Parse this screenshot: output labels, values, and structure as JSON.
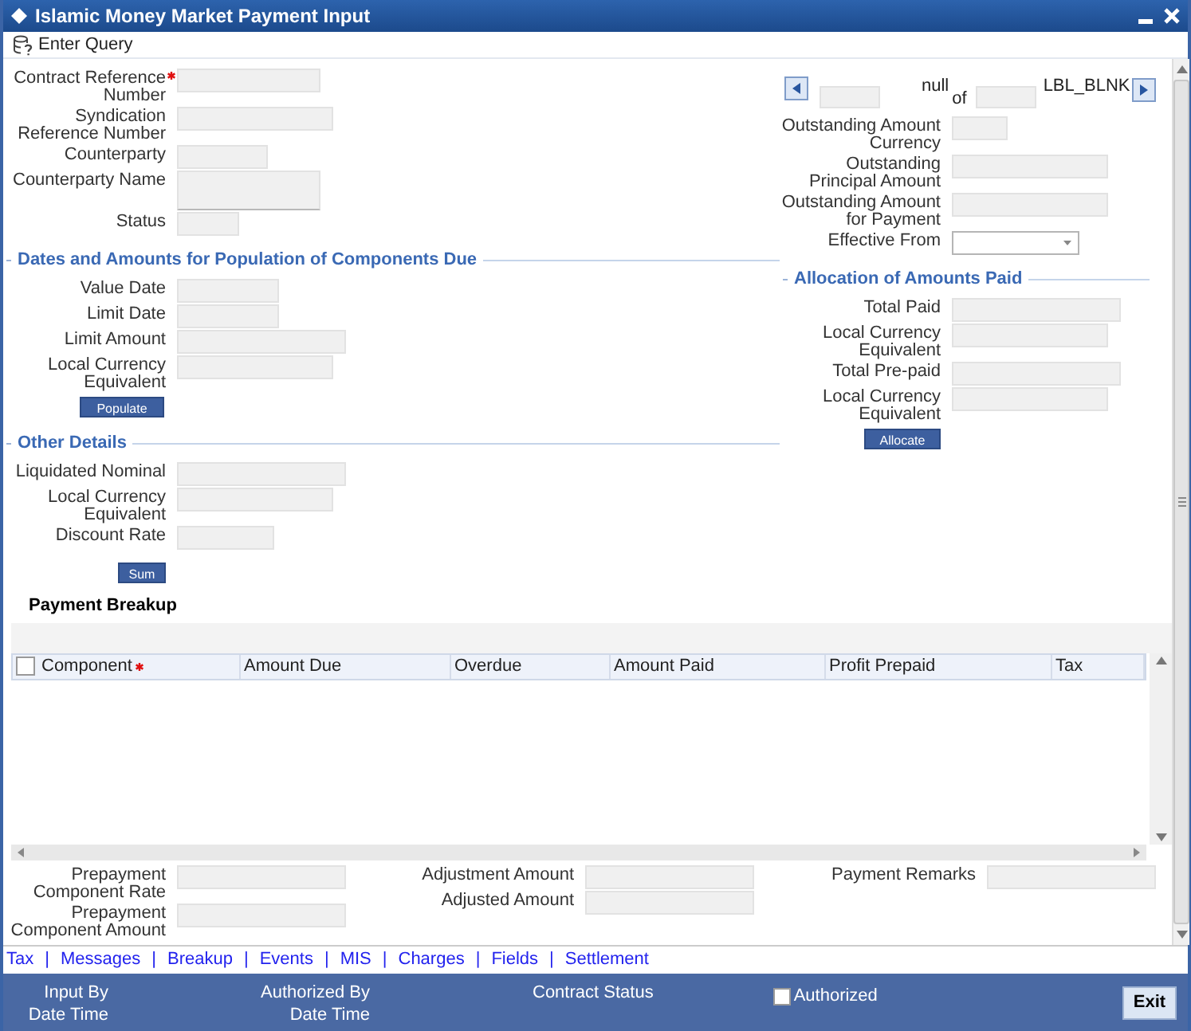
{
  "window": {
    "title": "Islamic Money Market Payment Input"
  },
  "toolbar": {
    "label": "Enter Query"
  },
  "contract_fields": [
    {
      "label": "Contract Reference Number",
      "required": true,
      "kind": "text"
    },
    {
      "label": "Syndication Reference Number",
      "required": false,
      "kind": "text"
    },
    {
      "label": "Counterparty",
      "required": false,
      "kind": "text"
    },
    {
      "label": "Counterparty Name",
      "required": false,
      "kind": "textarea"
    },
    {
      "label": "Status",
      "required": false,
      "kind": "text"
    }
  ],
  "dates_section": {
    "title": "Dates and Amounts for Population of Components Due",
    "fields": [
      {
        "label": "Value Date",
        "required": false,
        "kind": "text"
      },
      {
        "label": "Limit Date",
        "required": false,
        "kind": "text"
      },
      {
        "label": "Limit Amount",
        "required": false,
        "kind": "text"
      },
      {
        "label": "Local Currency Equivalent",
        "required": false,
        "kind": "text"
      }
    ],
    "button": "Populate"
  },
  "other_details": {
    "title": "Other Details",
    "fields": [
      {
        "label": "Liquidated Nominal",
        "required": false,
        "kind": "text"
      },
      {
        "label": "Local Currency Equivalent",
        "required": false,
        "kind": "text"
      },
      {
        "label": "Discount Rate",
        "required": false,
        "kind": "text"
      }
    ],
    "button": "Sum"
  },
  "navigator": {
    "current_label": "null",
    "of_label": "of",
    "total_label": "LBL_BLNK"
  },
  "outstanding_fields": [
    {
      "label": "Outstanding Amount Currency",
      "required": false,
      "kind": "text"
    },
    {
      "label": "Outstanding Principal Amount",
      "required": false,
      "kind": "text"
    },
    {
      "label": "Outstanding Amount for Payment",
      "required": false,
      "kind": "text"
    },
    {
      "label": "Effective From",
      "required": false,
      "kind": "select"
    }
  ],
  "allocation": {
    "title": "Allocation of Amounts Paid",
    "fields": [
      {
        "label": "Total Paid",
        "required": false,
        "kind": "text"
      },
      {
        "label": "Local Currency Equivalent",
        "required": false,
        "kind": "text"
      },
      {
        "label": "Total Pre-paid",
        "required": false,
        "kind": "text"
      },
      {
        "label": "Local Currency Equivalent",
        "required": false,
        "kind": "text"
      }
    ],
    "button": "Allocate"
  },
  "payment_breakup": {
    "title": "Payment Breakup",
    "select_all_checked": false,
    "columns": [
      {
        "label": "Component",
        "required": true
      },
      {
        "label": "Amount Due",
        "required": false
      },
      {
        "label": "Overdue",
        "required": false
      },
      {
        "label": "Amount Paid",
        "required": false
      },
      {
        "label": "Profit Prepaid",
        "required": false
      },
      {
        "label": "Tax",
        "required": false
      }
    ]
  },
  "bottom_fields": [
    [
      {
        "label": "Prepayment Component Rate",
        "required": false,
        "kind": "text"
      },
      {
        "label": "Prepayment Component Amount",
        "required": false,
        "kind": "text"
      }
    ],
    [
      {
        "label": "Adjustment Amount",
        "required": false,
        "kind": "text"
      },
      {
        "label": "Adjusted Amount",
        "required": false,
        "kind": "text"
      }
    ],
    [
      {
        "label": "Payment Remarks",
        "required": false,
        "kind": "text"
      }
    ]
  ],
  "links": {
    "separator": "|",
    "items": [
      "Tax",
      "Messages",
      "Breakup",
      "Events",
      "MIS",
      "Charges",
      "Fields",
      "Settlement"
    ]
  },
  "footer": {
    "input_by": "Input By",
    "input_date_time": "Date Time",
    "authorized_by": "Authorized By",
    "authorized_date_time": "Date Time",
    "contract_status": "Contract Status",
    "authorized": {
      "label": "Authorized",
      "checked": false
    },
    "exit": "Exit"
  }
}
